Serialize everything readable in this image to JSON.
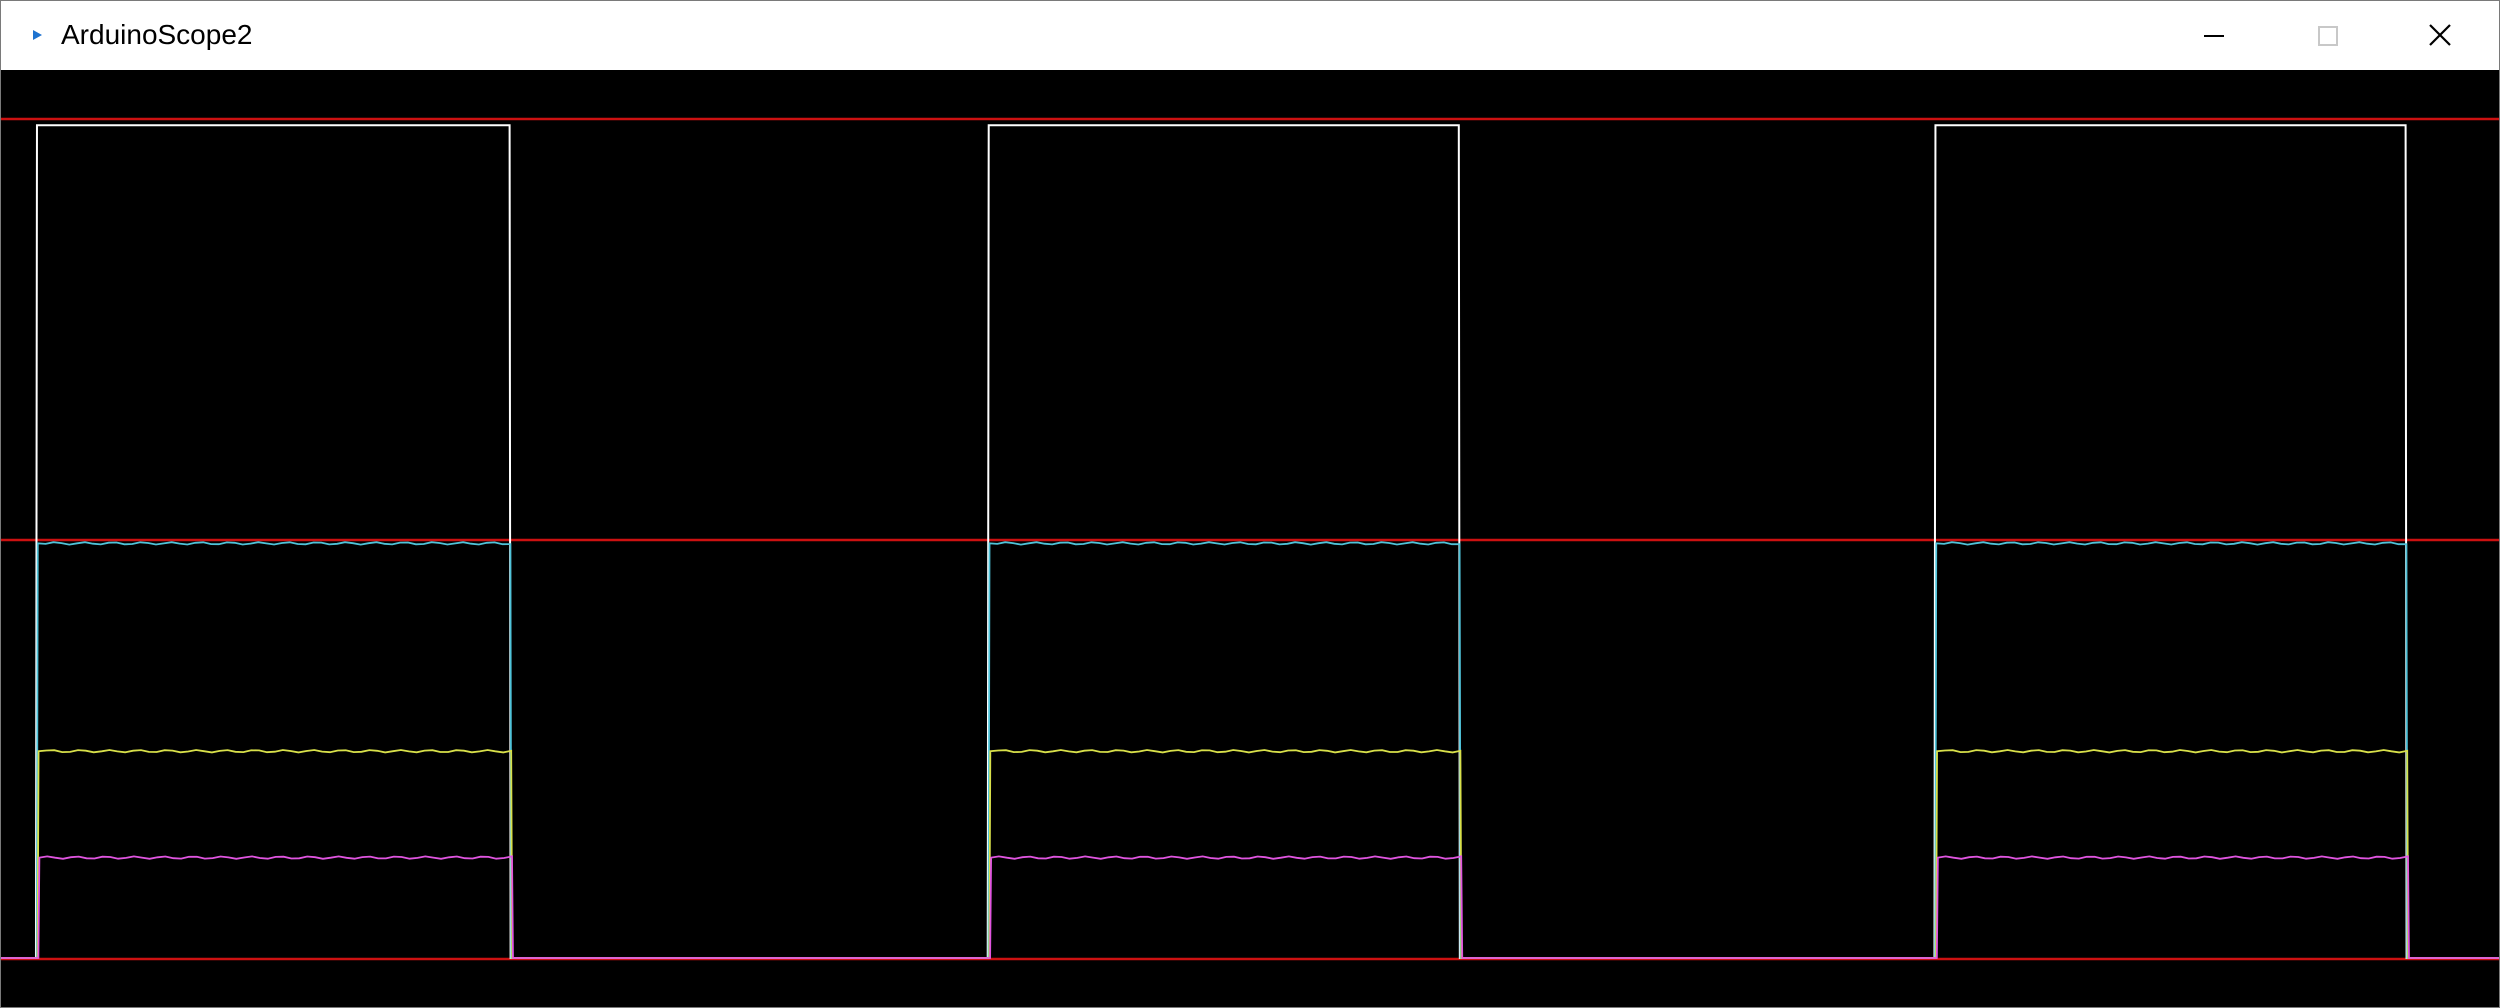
{
  "window": {
    "title": "ArduinoScope2",
    "controls": {
      "minimize": "minimize-icon",
      "maximize": "maximize-icon",
      "close": "close-icon"
    }
  },
  "colors": {
    "background": "#000000",
    "reference_line": "#cc1111",
    "channel_1": "#ffffff",
    "channel_2": "#4fc3d9",
    "channel_3": "#d8e04a",
    "channel_4": "#e055e0",
    "app_icon": "#1e73d0"
  },
  "scope": {
    "reference_levels": [
      1.0,
      0.5,
      0.0
    ],
    "pulses": [
      {
        "start": 0.014,
        "end": 0.204
      },
      {
        "start": 0.395,
        "end": 0.584
      },
      {
        "start": 0.774,
        "end": 0.963
      }
    ],
    "channels": [
      {
        "id": "ch1",
        "level": 0.995
      },
      {
        "id": "ch2",
        "level": 0.496
      },
      {
        "id": "ch3",
        "level": 0.248
      },
      {
        "id": "ch4",
        "level": 0.121
      }
    ]
  }
}
